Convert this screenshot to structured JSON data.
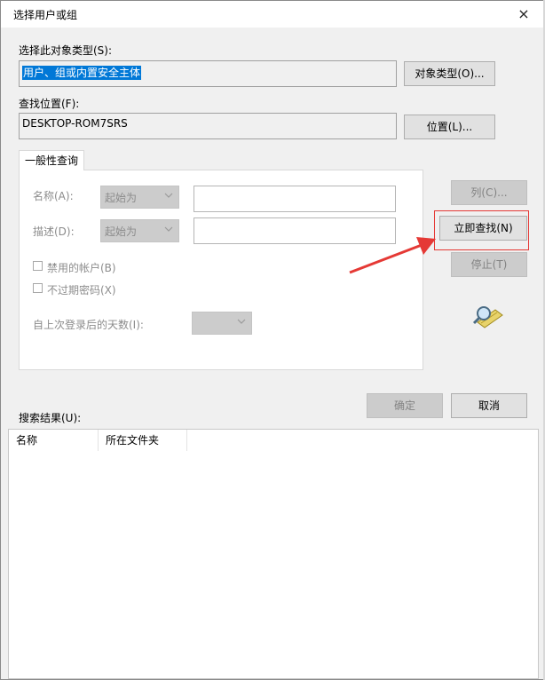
{
  "dialog": {
    "title": "选择用户或组",
    "close_glyph": "×"
  },
  "object_type": {
    "label": "选择此对象类型(S):",
    "value": "用户、组或内置安全主体",
    "button": "对象类型(O)..."
  },
  "location": {
    "label": "查找位置(F):",
    "value": "DESKTOP-ROM7SRS",
    "button": "位置(L)..."
  },
  "query": {
    "tab_label": "一般性查询",
    "name_label": "名称(A):",
    "name_mode": "起始为",
    "desc_label": "描述(D):",
    "desc_mode": "起始为",
    "disabled_accounts": "禁用的帐户(B)",
    "non_expiring": "不过期密码(X)",
    "days_label": "自上次登录后的天数(I):"
  },
  "buttons": {
    "columns": "列(C)...",
    "find_now": "立即查找(N)",
    "stop": "停止(T)",
    "ok": "确定",
    "cancel": "取消"
  },
  "results": {
    "label": "搜索结果(U):",
    "columns": [
      "名称",
      "所在文件夹"
    ]
  },
  "colors": {
    "selection": "#0078d7",
    "annotation_red": "#e53935"
  },
  "icons": {
    "search": "magnifier-search-icon",
    "close": "close-icon",
    "dropdown": "chevron-down-icon"
  }
}
